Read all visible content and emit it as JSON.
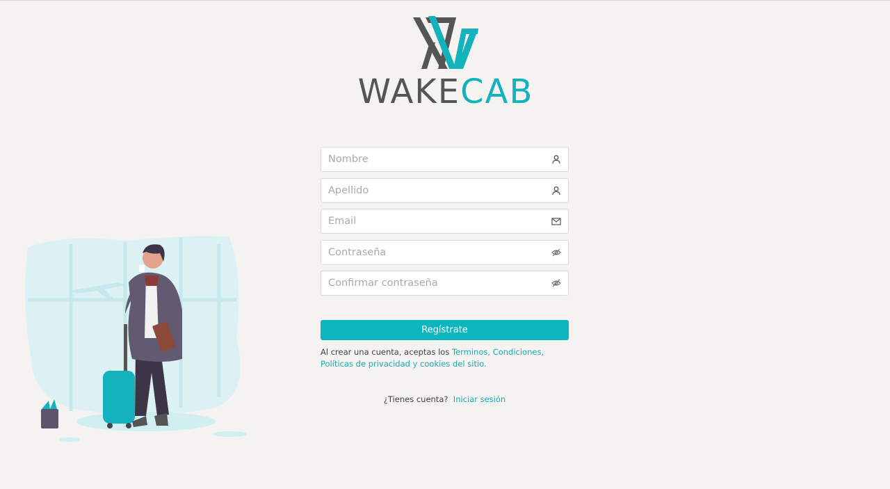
{
  "brand": {
    "name_part1": "WAKE",
    "name_part2": "CAB",
    "colors": {
      "dark": "#555555",
      "teal": "#14b2bc"
    }
  },
  "form": {
    "fields": [
      {
        "name": "first-name",
        "placeholder": "Nombre",
        "icon": "user-icon"
      },
      {
        "name": "last-name",
        "placeholder": "Apellido",
        "icon": "user-icon"
      },
      {
        "name": "email",
        "placeholder": "Email",
        "icon": "envelope-icon"
      },
      {
        "name": "password",
        "placeholder": "Contraseña",
        "icon": "eye-slash-icon"
      },
      {
        "name": "confirm-password",
        "placeholder": "Confirmar contraseña",
        "icon": "eye-slash-icon"
      }
    ],
    "submit_label": "Regístrate"
  },
  "terms": {
    "prefix": "Al crear una cuenta, aceptas los ",
    "link1": "Terminos",
    "sep1": ", ",
    "link2": "Condiciones,",
    "link3": "Políticas de privacidad y cookies del sitio."
  },
  "login": {
    "question": "¿Tienes cuenta?",
    "link": "Iniciar sesión"
  },
  "colors": {
    "accent": "#0db5bf",
    "background": "#f4f3f1"
  }
}
